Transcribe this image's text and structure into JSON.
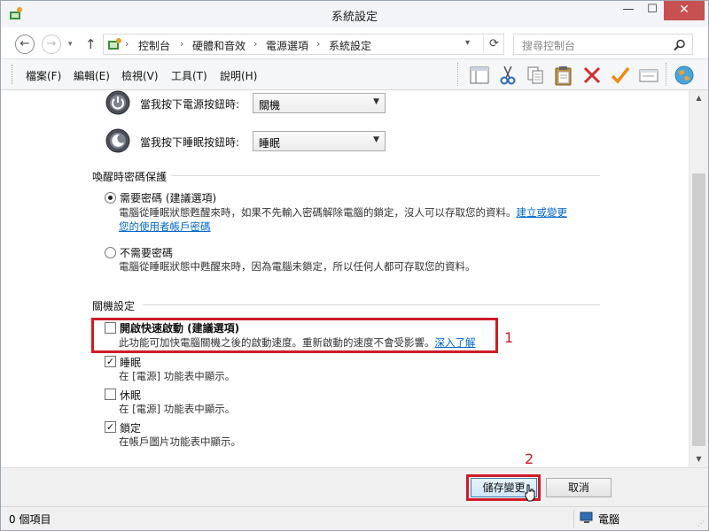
{
  "window": {
    "title": "系統設定",
    "minimize": "—",
    "maximize": "☐",
    "close": "✕"
  },
  "address": {
    "crumbs": [
      "控制台",
      "硬體和音效",
      "電源選項",
      "系統設定"
    ],
    "search_placeholder": "搜尋控制台"
  },
  "menu": {
    "items": [
      "檔案(F)",
      "編輯(E)",
      "檢視(V)",
      "工具(T)",
      "說明(H)"
    ]
  },
  "toolbar_icons": [
    "layout-icon",
    "cut-icon",
    "copy-icon",
    "paste-icon",
    "delete-icon",
    "check-icon",
    "properties-icon",
    "globe-icon"
  ],
  "power_buttons": {
    "power_label": "當我按下電源按鈕時:",
    "power_value": "關機",
    "sleep_label": "當我按下睡眠按鈕時:",
    "sleep_value": "睡眠"
  },
  "password": {
    "group_title": "喚醒時密碼保護",
    "require": {
      "title": "需要密碼 (建議選項)",
      "desc_line1": "電腦從睡眠狀態甦醒來時，如果不先輸入密碼解除電腦的鎖定，沒人可以存取您的資料。",
      "link_part1": "建立或變更",
      "link_part2": "您的使用者帳戶密碼",
      "checked": true
    },
    "no_require": {
      "title": "不需要密碼",
      "desc": "電腦從睡眠狀態中甦醒來時，因為電腦未鎖定，所以任何人都可存取您的資料。",
      "checked": false
    }
  },
  "shutdown": {
    "group_title": "關機設定",
    "fast_startup": {
      "title": "開啟快速啟動 (建議選項)",
      "desc": "此功能可加快電腦關機之後的啟動速度。重新啟動的速度不會受影響。",
      "link": "深入了解",
      "checked": false
    },
    "sleep": {
      "title": "睡眠",
      "desc": "在 [電源] 功能表中顯示。",
      "checked": true
    },
    "hibernate": {
      "title": "休眠",
      "desc": "在 [電源] 功能表中顯示。",
      "checked": false
    },
    "lock": {
      "title": "鎖定",
      "desc": "在帳戶圖片功能表中顯示。",
      "checked": true
    }
  },
  "annotations": {
    "one": "1",
    "two": "2"
  },
  "buttons": {
    "save": "儲存變更",
    "cancel": "取消"
  },
  "status": {
    "items": "0 個項目",
    "computer": "電腦"
  },
  "colors": {
    "highlight": "#d01b27",
    "link": "#0066cc",
    "close_button": "#c75050"
  }
}
